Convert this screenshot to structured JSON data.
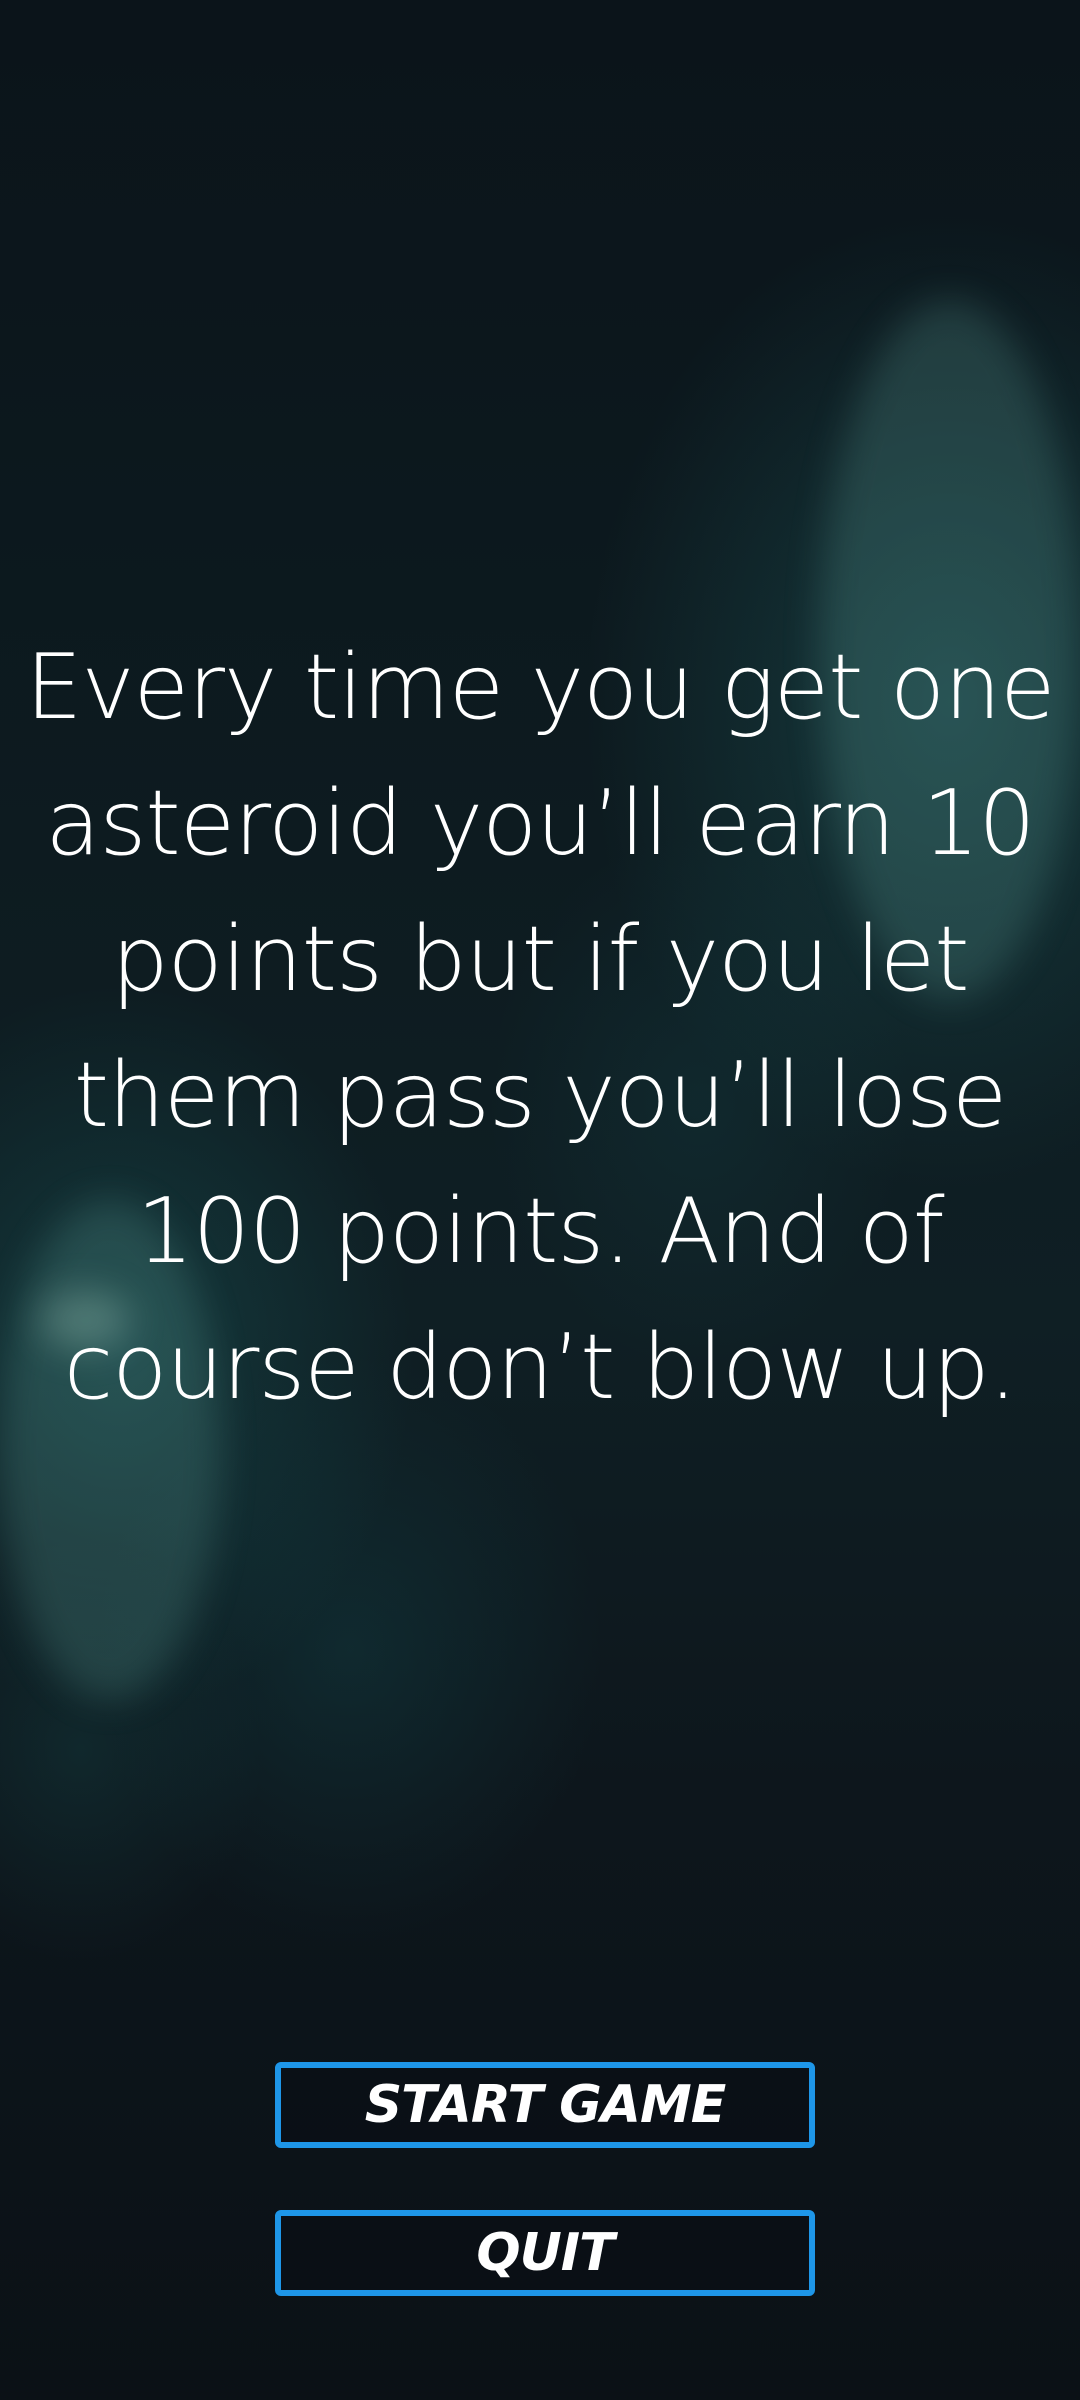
{
  "instructions": {
    "text": "Every time you get one asteroid you’ll earn 10 points but if you let them pass you’ll lose 100 points. And of course don’t blow up."
  },
  "buttons": {
    "start_label": "START GAME",
    "quit_label": "QUIT"
  },
  "colors": {
    "button_border": "#1e96e8",
    "background": "#0d141b",
    "text": "#ffffff"
  }
}
